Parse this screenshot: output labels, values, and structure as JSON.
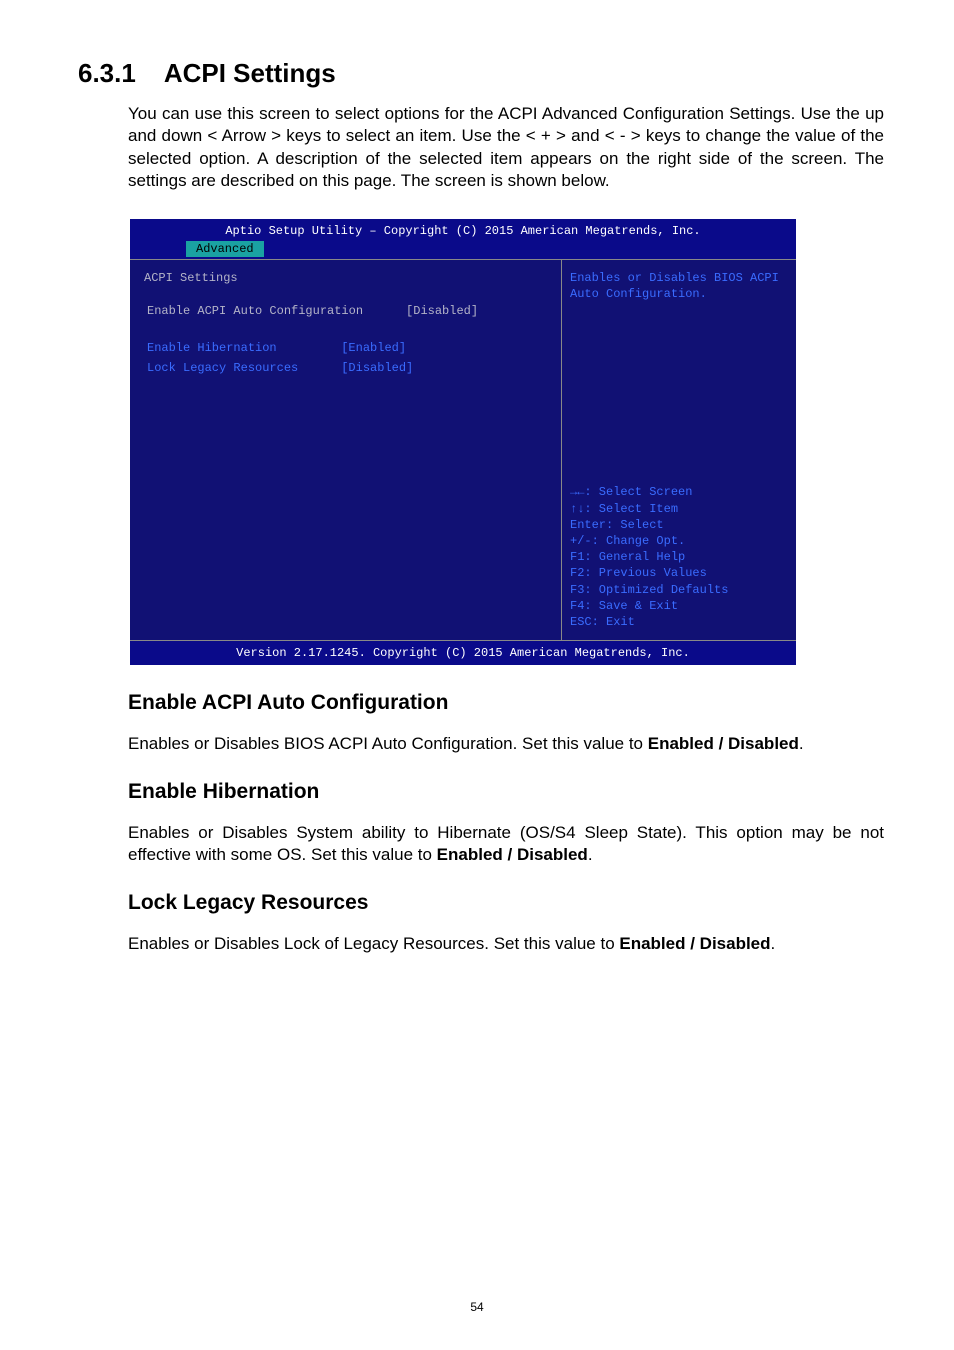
{
  "page_number": "54",
  "section": {
    "number": "6.3.1",
    "title": "ACPI Settings"
  },
  "intro": "You can use this screen to select options for the ACPI Advanced Configuration Settings. Use the up and down < Arrow > keys to select an item. Use the < + > and < - > keys to change the value of the selected option. A description of the selected item appears on the right side of the screen. The settings are described on this page. The screen is shown below.",
  "bios": {
    "title": "Aptio Setup Utility – Copyright (C) 2015 American Megatrends, Inc.",
    "footer": "Version 2.17.1245. Copyright (C) 2015 American Megatrends, Inc.",
    "tab": "Advanced",
    "heading": "ACPI Settings",
    "rows": [
      {
        "label": "Enable ACPI Auto Configuration",
        "value": "[Disabled]"
      },
      {
        "label": "Enable Hibernation",
        "value": "[Enabled]"
      },
      {
        "label": "Lock Legacy Resources",
        "value": "[Disabled]"
      }
    ],
    "help_top": "Enables or Disables BIOS ACPI Auto Configuration.",
    "help_keys": [
      "→←: Select Screen",
      "↑↓: Select Item",
      "Enter: Select",
      "+/-: Change Opt.",
      "F1: General Help",
      "F2: Previous Values",
      "F3: Optimized Defaults",
      "F4: Save & Exit",
      "ESC: Exit"
    ]
  },
  "sub1": {
    "title": "Enable ACPI Auto Configuration",
    "text_a": "Enables or Disables BIOS ACPI Auto Configuration. Set this value to ",
    "bold": "Enabled / Disabled",
    "text_b": "."
  },
  "sub2": {
    "title": "Enable Hibernation",
    "text_a": "Enables or Disables System ability to Hibernate (OS/S4 Sleep State). This option may be not effective with some OS. Set this value to ",
    "bold": "Enabled / Disabled",
    "text_b": "."
  },
  "sub3": {
    "title": "Lock Legacy Resources",
    "text_a": "Enables or Disables Lock of Legacy Resources. Set this value to ",
    "bold": "Enabled / Disabled",
    "text_b": "."
  }
}
